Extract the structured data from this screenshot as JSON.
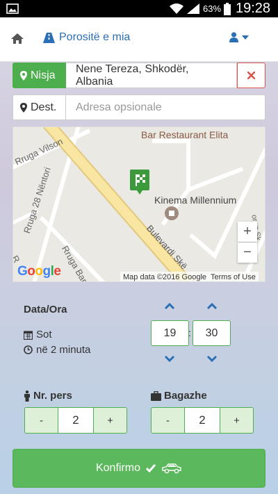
{
  "statusbar": {
    "battery_percent": "63%",
    "time": "19:28"
  },
  "navbar": {
    "orders_label": "Porositë e mia"
  },
  "origin": {
    "label": "Nisja",
    "value": "Nene Tereza, Shkodër, Albania"
  },
  "destination": {
    "label": "Dest.",
    "placeholder": "Adresa opsionale"
  },
  "map": {
    "poi_bar": "Bar Restaurant Elita",
    "poi_kinema": "Kinema Millennium",
    "street_vilson": "Rruga Vilson",
    "street_28_nentori": "Rruga 28 Nëntori",
    "street_bar": "Rruga Bar",
    "street_bulevardi": "Bulevardi Skë",
    "street_r": "R",
    "street_oren": "oren Sk",
    "zoom_in": "+",
    "zoom_out": "−",
    "google": [
      "G",
      "o",
      "o",
      "g",
      "l",
      "e"
    ],
    "attribution": "Map data ©2016 Google",
    "terms": "Terms of Use"
  },
  "datetime": {
    "title": "Data/Ora",
    "day": "Sot",
    "relative": "në 2 minuta",
    "hour": "19",
    "minute": "30",
    "separator": ":"
  },
  "persons": {
    "label": "Nr. pers",
    "minus": "-",
    "value": "2",
    "plus": "+"
  },
  "luggage": {
    "label": "Bagazhe",
    "minus": "-",
    "value": "2",
    "plus": "+"
  },
  "confirm": {
    "label": "Konfirmo"
  },
  "colors": {
    "green": "#5cb85c",
    "blue": "#2a6fb5",
    "red": "#d9534f"
  }
}
